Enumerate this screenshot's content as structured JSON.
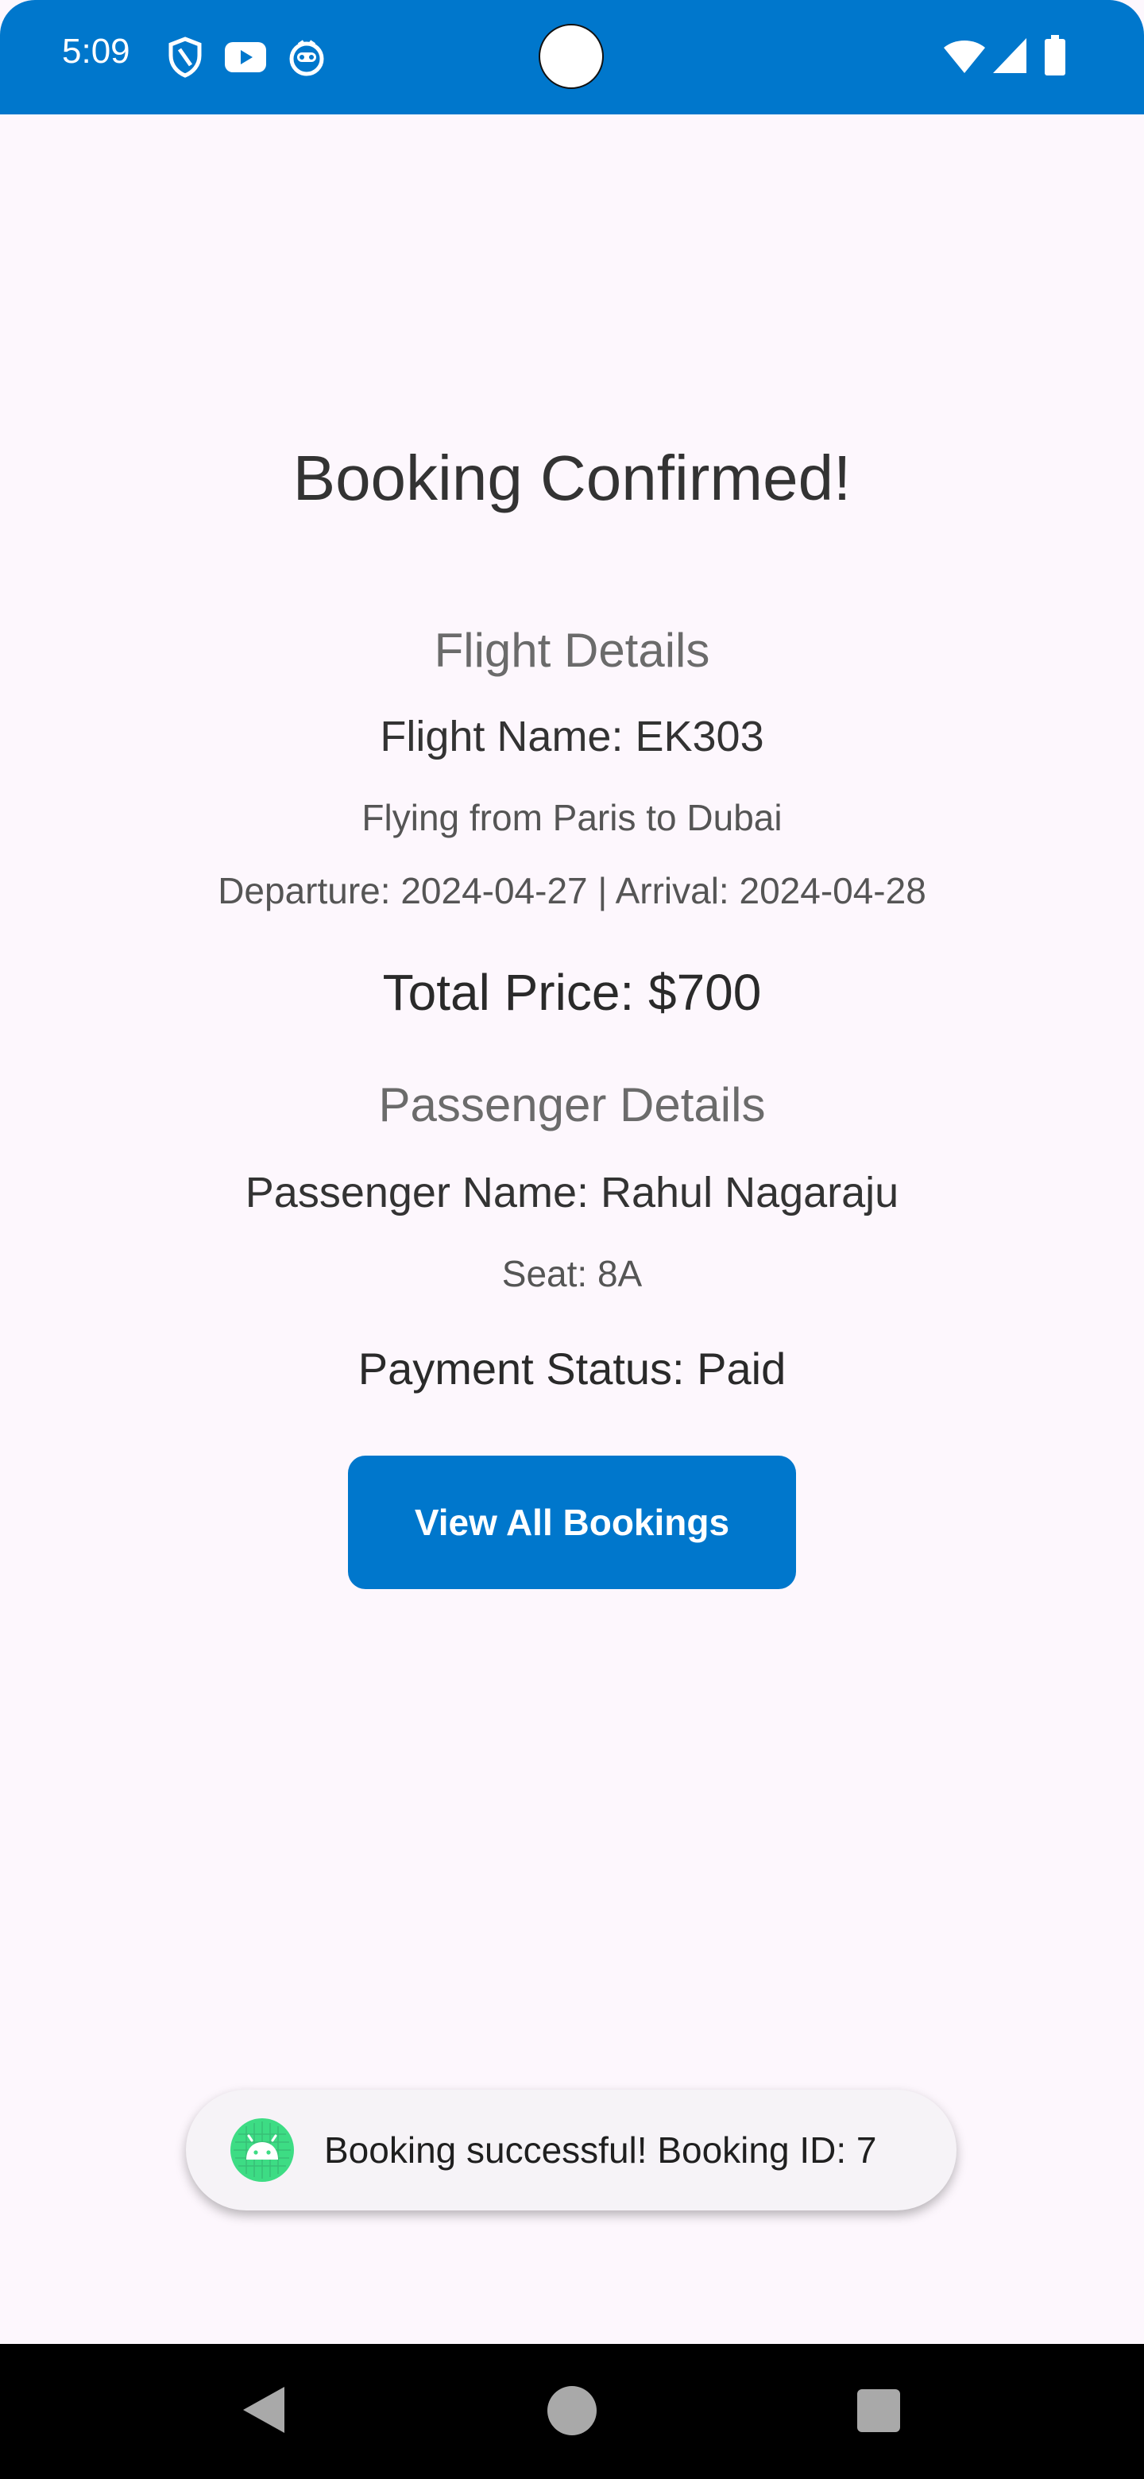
{
  "status_bar": {
    "time": "5:09",
    "left_icons": [
      "shield-icon",
      "youtube-icon",
      "robot-face-icon"
    ],
    "right_icons": [
      "wifi-icon",
      "cellular-signal-icon",
      "battery-icon"
    ],
    "background_color": "#0077cc"
  },
  "confirmation": {
    "title": "Booking Confirmed!",
    "flight_section": {
      "heading": "Flight Details",
      "flight_name": "Flight Name: EK303",
      "route": "Flying from Paris to Dubai",
      "dates": "Departure: 2024-04-27 | Arrival: 2024-04-28"
    },
    "total_price": "Total Price: $700",
    "passenger_section": {
      "heading": "Passenger Details",
      "passenger_name": "Passenger Name: Rahul Nagaraju",
      "seat": "Seat: 8A"
    },
    "payment_status": "Payment Status: Paid",
    "view_all_button_label": "View All Bookings",
    "accent_color": "#0077cc"
  },
  "toast": {
    "message": "Booking successful! Booking ID: 7",
    "icon": "android-app-icon"
  },
  "nav_bar": {
    "buttons": [
      "back-icon",
      "home-icon",
      "recents-icon"
    ]
  }
}
